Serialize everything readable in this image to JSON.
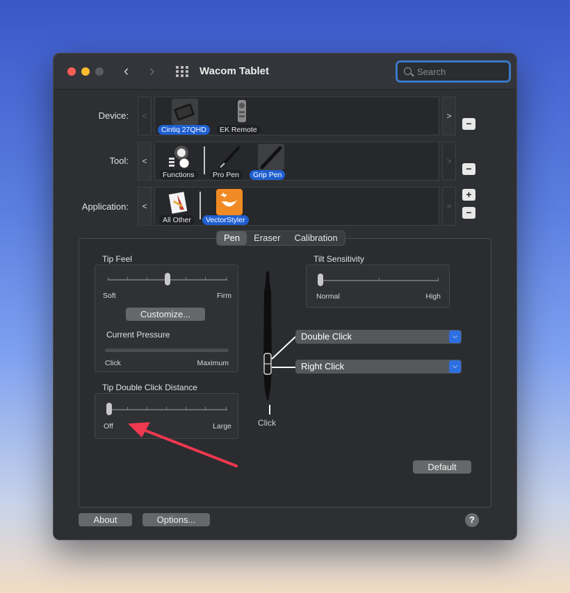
{
  "window": {
    "title": "Wacom Tablet",
    "search_placeholder": "Search"
  },
  "rows": {
    "device_label": "Device:",
    "tool_label": "Tool:",
    "application_label": "Application:"
  },
  "devices": [
    {
      "label": "Cintiq 27QHD",
      "selected": true
    },
    {
      "label": "EK Remote",
      "selected": false
    }
  ],
  "tools": [
    {
      "label": "Functions",
      "selected": false
    },
    {
      "label": "Pro Pen",
      "selected": false
    },
    {
      "label": "Grip Pen",
      "selected": true
    }
  ],
  "applications": [
    {
      "label": "All Other",
      "selected": false
    },
    {
      "label": "VectorStyler",
      "selected": true
    }
  ],
  "buttons": {
    "nav_prev": "<",
    "nav_next": ">",
    "add": "+",
    "remove": "−",
    "customize": "Customize...",
    "default": "Default",
    "about": "About",
    "options": "Options...",
    "help": "?"
  },
  "tabs": [
    {
      "label": "Pen",
      "active": true
    },
    {
      "label": "Eraser",
      "active": false
    },
    {
      "label": "Calibration",
      "active": false
    }
  ],
  "tip_feel": {
    "title": "Tip Feel",
    "min_label": "Soft",
    "max_label": "Firm",
    "value_fraction": 0.5
  },
  "current_pressure": {
    "title": "Current Pressure",
    "min_label": "Click",
    "max_label": "Maximum",
    "value_fraction": 0
  },
  "tip_double_click": {
    "title": "Tip Double Click Distance",
    "min_label": "Off",
    "max_label": "Large",
    "value_fraction": 0
  },
  "tilt_sensitivity": {
    "title": "Tilt Sensitivity",
    "min_label": "Normal",
    "max_label": "High",
    "value_fraction": 0
  },
  "pen_buttons": {
    "upper": "Double Click",
    "lower": "Right Click",
    "tip": "Click"
  },
  "colors": {
    "accent": "#1f5fd1",
    "annotation_arrow": "#f0384f"
  }
}
